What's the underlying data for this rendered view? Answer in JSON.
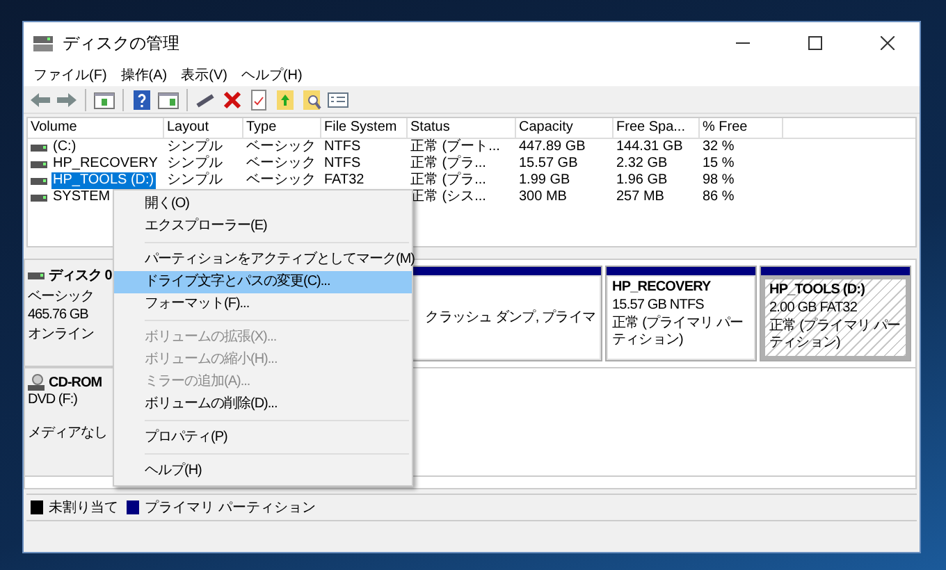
{
  "window": {
    "title": "ディスクの管理"
  },
  "menu_bar": [
    "ファイル(F)",
    "操作(A)",
    "表示(V)",
    "ヘルプ(H)"
  ],
  "volume_table": {
    "columns": [
      "Volume",
      "Layout",
      "Type",
      "File System",
      "Status",
      "Capacity",
      "Free Spa...",
      "% Free"
    ],
    "rows": [
      {
        "volume": "(C:)",
        "layout": "シンプル",
        "type": "ベーシック",
        "file_system": "NTFS",
        "status": "正常 (ブート...",
        "capacity": "447.89 GB",
        "free_space": "144.31 GB",
        "percent_free": "32 %",
        "selected": false
      },
      {
        "volume": "HP_RECOVERY",
        "layout": "シンプル",
        "type": "ベーシック",
        "file_system": "NTFS",
        "status": "正常 (プラ...",
        "capacity": "15.57 GB",
        "free_space": "2.32 GB",
        "percent_free": "15 %",
        "selected": false
      },
      {
        "volume": "HP_TOOLS (D:)",
        "layout": "シンプル",
        "type": "ベーシック",
        "file_system": "FAT32",
        "status": "正常 (プラ...",
        "capacity": "1.99 GB",
        "free_space": "1.96 GB",
        "percent_free": "98 %",
        "selected": true
      },
      {
        "volume": "SYSTEM",
        "status": "正常 (シス...",
        "capacity": "300 MB",
        "free_space": "257 MB",
        "percent_free": "86 %",
        "selected": false
      }
    ]
  },
  "disks": [
    {
      "kind": "disk",
      "name": "ディスク 0",
      "lines": [
        "ベーシック",
        "465.76 GB",
        "オンライン"
      ],
      "partitions": [
        {
          "lines": [
            "クラッシュ ダンプ, プライマ"
          ],
          "selected": false
        },
        {
          "name": "HP_RECOVERY",
          "lines": [
            "15.57 GB NTFS",
            "正常 (プライマリ パーティション)"
          ],
          "selected": false
        },
        {
          "name": "HP_TOOLS  (D:)",
          "lines": [
            "2.00 GB FAT32",
            "正常 (プライマリ パーティション)"
          ],
          "selected": true
        }
      ]
    },
    {
      "kind": "cdrom",
      "name": "CD-ROM",
      "lines": [
        "DVD (F:)",
        "メディアなし"
      ]
    }
  ],
  "legend": [
    {
      "label": "未割り当て",
      "color": "#000000"
    },
    {
      "label": "プライマリ パーティション",
      "color": "#000080"
    }
  ],
  "context_menu": [
    {
      "kind": "item",
      "label": "開く(O)",
      "disabled": false,
      "selected": false
    },
    {
      "kind": "item",
      "label": "エクスプローラー(E)",
      "disabled": false,
      "selected": false
    },
    {
      "kind": "separator"
    },
    {
      "kind": "item",
      "label": "パーティションをアクティブとしてマーク(M)",
      "disabled": false,
      "selected": false
    },
    {
      "kind": "item",
      "label": "ドライブ文字とパスの変更(C)...",
      "disabled": false,
      "selected": true
    },
    {
      "kind": "item",
      "label": "フォーマット(F)...",
      "disabled": false,
      "selected": false
    },
    {
      "kind": "separator"
    },
    {
      "kind": "item",
      "label": "ボリュームの拡張(X)...",
      "disabled": true,
      "selected": false
    },
    {
      "kind": "item",
      "label": "ボリュームの縮小(H)...",
      "disabled": true,
      "selected": false
    },
    {
      "kind": "item",
      "label": "ミラーの追加(A)...",
      "disabled": true,
      "selected": false
    },
    {
      "kind": "item",
      "label": "ボリュームの削除(D)...",
      "disabled": false,
      "selected": false
    },
    {
      "kind": "separator"
    },
    {
      "kind": "item",
      "label": "プロパティ(P)",
      "disabled": false,
      "selected": false
    },
    {
      "kind": "separator"
    },
    {
      "kind": "item",
      "label": "ヘルプ(H)",
      "disabled": false,
      "selected": false
    }
  ]
}
